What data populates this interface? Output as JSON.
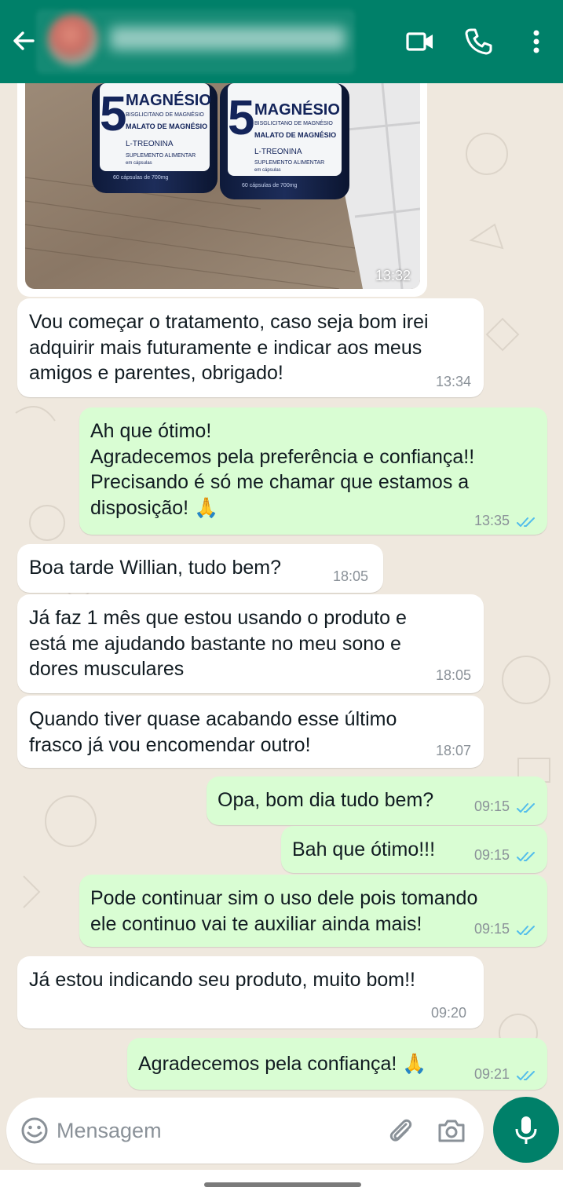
{
  "header": {
    "contact_name_hidden": true
  },
  "photo_message": {
    "time": "13:32",
    "product_label": {
      "brand_number": "5",
      "title": "MAGNÉSIO",
      "line1": "BISGLICITANO DE MAGNÉSIO",
      "line2": "MALATO DE MAGNÉSIO",
      "line3": "L-TREONINA",
      "line4": "SUPLEMENTO ALIMENTAR",
      "line5": "em cápsulas",
      "line6": "60 cápsulas de 700mg"
    }
  },
  "messages": [
    {
      "id": "m1",
      "direction": "in",
      "text": "Vou começar o tratamento, caso seja bom irei\nadquirir mais futuramente e indicar aos meus\namigos e parentes, obrigado!",
      "time": "13:34"
    },
    {
      "id": "m2",
      "direction": "out",
      "text": "Ah que ótimo!\nAgradecemos pela preferência e confiança!!\nPrecisando é só me chamar que estamos a\ndisposição! 🙏",
      "time": "13:35",
      "read": true
    },
    {
      "id": "m3",
      "direction": "in",
      "text": "Boa tarde Willian, tudo bem?",
      "time": "18:05"
    },
    {
      "id": "m4",
      "direction": "in",
      "text": "Já faz 1 mês que estou usando o produto e\nestá me ajudando bastante no meu sono e\ndores musculares",
      "time": "18:05"
    },
    {
      "id": "m5",
      "direction": "in",
      "text": "Quando tiver quase acabando esse último\nfrasco já vou encomendar outro!",
      "time": "18:07"
    },
    {
      "id": "m6",
      "direction": "out",
      "text": "Opa, bom dia tudo bem?",
      "time": "09:15",
      "read": true
    },
    {
      "id": "m7",
      "direction": "out",
      "text": "Bah que ótimo!!!",
      "time": "09:15",
      "read": true
    },
    {
      "id": "m8",
      "direction": "out",
      "text": "Pode continuar sim o uso dele pois tomando\nele continuo vai te auxiliar ainda mais!",
      "time": "09:15",
      "read": true
    },
    {
      "id": "m9",
      "direction": "in",
      "text": "Já estou indicando seu produto, muito bom!!",
      "time": "09:20"
    },
    {
      "id": "m10",
      "direction": "out",
      "text": "Agradecemos pela confiança! 🙏",
      "time": "09:21",
      "read": true
    }
  ],
  "input": {
    "placeholder": "Mensagem",
    "value": ""
  },
  "colors": {
    "header": "#008069",
    "chat_background": "#efe8de",
    "incoming_bubble": "#ffffff",
    "outgoing_bubble": "#d9fdd3",
    "read_ticks": "#53bdeb",
    "timestamp": "#8a9198"
  },
  "icons": [
    "back-arrow-icon",
    "video-call-icon",
    "phone-icon",
    "more-options-icon",
    "emoji-icon",
    "attach-icon",
    "camera-icon",
    "mic-icon",
    "read-ticks-icon"
  ]
}
